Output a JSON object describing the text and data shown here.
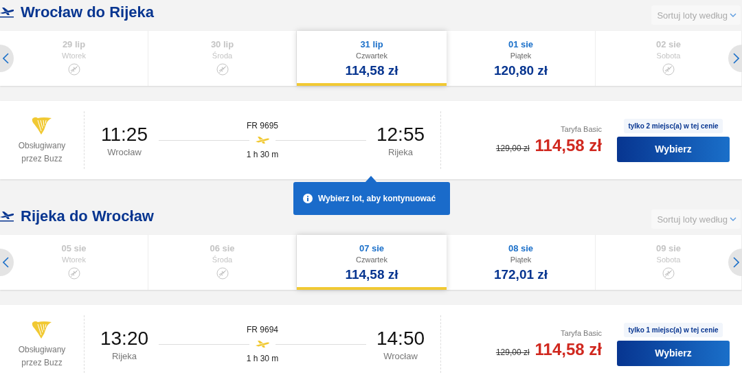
{
  "sections": [
    {
      "title": "Wrocław do Rijeka",
      "sort_label": "Sortuj loty według",
      "days": [
        {
          "kind": "none",
          "date": "29 lip",
          "weekday": "Wtorek",
          "selected": false
        },
        {
          "kind": "none",
          "date": "30 lip",
          "weekday": "Środa",
          "selected": false
        },
        {
          "kind": "price",
          "date": "31 lip",
          "weekday": "Czwartek",
          "price": "114,58 zł",
          "selected": true
        },
        {
          "kind": "price",
          "date": "01 sie",
          "weekday": "Piątek",
          "price": "120,80 zł",
          "selected": false
        },
        {
          "kind": "none",
          "date": "02 sie",
          "weekday": "Sobota",
          "selected": false
        }
      ],
      "flight": {
        "operator": "Obsługiwany przez Buzz",
        "departure_time": "11:25",
        "departure_city": "Wrocław",
        "flight_number": "FR 9695",
        "duration": "1 h 30 m",
        "arrival_time": "12:55",
        "arrival_city": "Rijeka",
        "fare_name": "Taryfa Basic",
        "old_price": "129,00 zł",
        "price": "114,58 zł",
        "seats_note": "tylko 2 miejsc(a) w tej cenie",
        "button": "Wybierz"
      }
    },
    {
      "title": "Rijeka do Wrocław",
      "sort_label": "Sortuj loty według",
      "days": [
        {
          "kind": "none",
          "date": "05 sie",
          "weekday": "Wtorek",
          "selected": false
        },
        {
          "kind": "none",
          "date": "06 sie",
          "weekday": "Środa",
          "selected": false
        },
        {
          "kind": "price",
          "date": "07 sie",
          "weekday": "Czwartek",
          "price": "114,58 zł",
          "selected": true
        },
        {
          "kind": "price",
          "date": "08 sie",
          "weekday": "Piątek",
          "price": "172,01 zł",
          "selected": false
        },
        {
          "kind": "none",
          "date": "09 sie",
          "weekday": "Sobota",
          "selected": false
        }
      ],
      "flight": {
        "operator": "Obsługiwany przez Buzz",
        "departure_time": "13:20",
        "departure_city": "Rijeka",
        "flight_number": "FR 9694",
        "duration": "1 h 30 m",
        "arrival_time": "14:50",
        "arrival_city": "Wrocław",
        "fare_name": "Taryfa Basic",
        "old_price": "129,00 zł",
        "price": "114,58 zł",
        "seats_note": "tylko 1 miejsc(a) w tej cenie",
        "button": "Wybierz"
      }
    }
  ],
  "tooltip": {
    "text": "Wybierz lot, aby kontynuować"
  }
}
